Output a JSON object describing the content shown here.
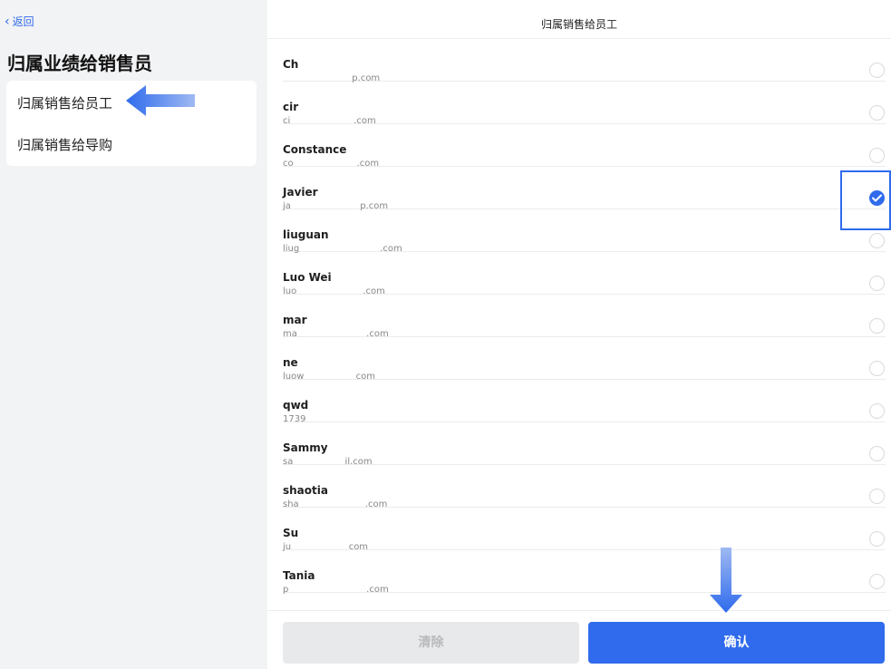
{
  "nav": {
    "back_label": "返回"
  },
  "left": {
    "title": "归属业绩给销售员",
    "menu": [
      {
        "label": "归属销售给员工"
      },
      {
        "label": "归属销售给导购"
      }
    ]
  },
  "header": {
    "title": "归属销售给员工"
  },
  "employees": [
    {
      "name": "Ch",
      "email": "                        p.com",
      "selected": false
    },
    {
      "name": "cir",
      "email": "ci                      .com",
      "selected": false
    },
    {
      "name": "Constance",
      "email": "co                      .com",
      "selected": false
    },
    {
      "name": "Javier",
      "email": "ja                        p.com",
      "selected": true
    },
    {
      "name": "liuguan",
      "email": "liug                            .com",
      "selected": false
    },
    {
      "name": "Luo Wei",
      "email": "luo                       .com",
      "selected": false
    },
    {
      "name": "mar",
      "email": "ma                        .com",
      "selected": false
    },
    {
      "name": "ne",
      "email": "luow                  com",
      "selected": false
    },
    {
      "name": "qwd",
      "email": "1739",
      "selected": false
    },
    {
      "name": "Sammy",
      "email": "sa                  il.com",
      "selected": false
    },
    {
      "name": "shaotia",
      "email": "sha                       .com",
      "selected": false
    },
    {
      "name": "Su",
      "email": "ju                    com",
      "selected": false
    },
    {
      "name": "Tania",
      "email": "p                           .com",
      "selected": false
    }
  ],
  "footer": {
    "clear_label": "清除",
    "confirm_label": "确认"
  },
  "colors": {
    "accent": "#2f6bec",
    "clear_bg": "#e8e9eb",
    "clear_text": "#b8b9bb"
  }
}
